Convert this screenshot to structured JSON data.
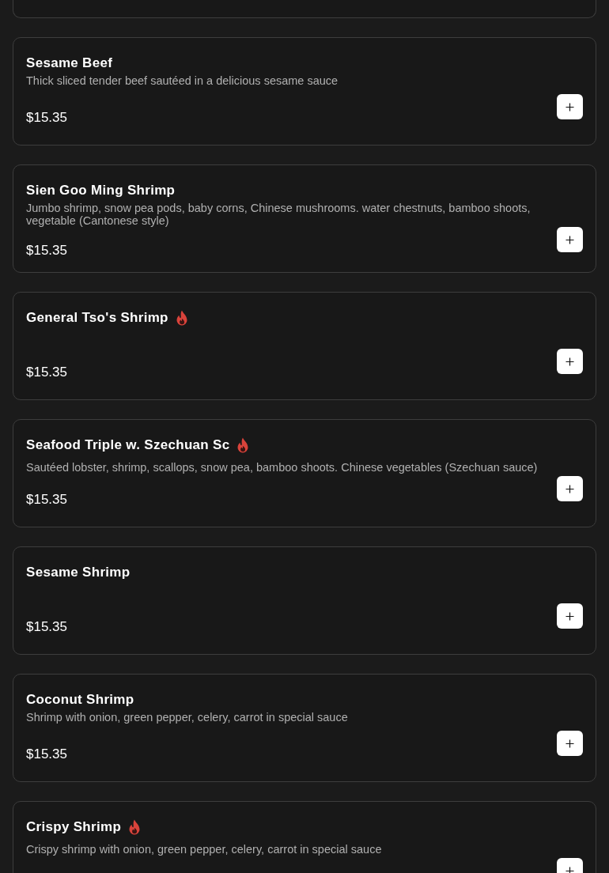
{
  "items": [
    {
      "name": "Sesame Beef",
      "spicy": false,
      "description": "Thick sliced tender beef sautéed in a delicious sesame sauce",
      "price": "$15.35"
    },
    {
      "name": "Sien Goo Ming Shrimp",
      "spicy": false,
      "description": "Jumbo shrimp, snow pea pods, baby corns, Chinese mushrooms. water chestnuts, bamboo shoots, vegetable (Cantonese style)",
      "price": "$15.35"
    },
    {
      "name": "General Tso's Shrimp",
      "spicy": true,
      "price": "$15.35"
    },
    {
      "name": "Seafood Triple w. Szechuan Sc",
      "spicy": true,
      "description": "Sautéed lobster, shrimp, scallops, snow pea, bamboo shoots. Chinese vegetables (Szechuan sauce)",
      "price": "$15.35"
    },
    {
      "name": "Sesame Shrimp",
      "spicy": false,
      "price": "$15.35"
    },
    {
      "name": "Coconut Shrimp",
      "spicy": false,
      "description": "Shrimp with onion, green pepper, celery, carrot in special sauce",
      "price": "$15.35"
    },
    {
      "name": "Crispy Shrimp",
      "spicy": true,
      "description": "Crispy shrimp with onion, green pepper, celery, carrot in special sauce"
    }
  ]
}
